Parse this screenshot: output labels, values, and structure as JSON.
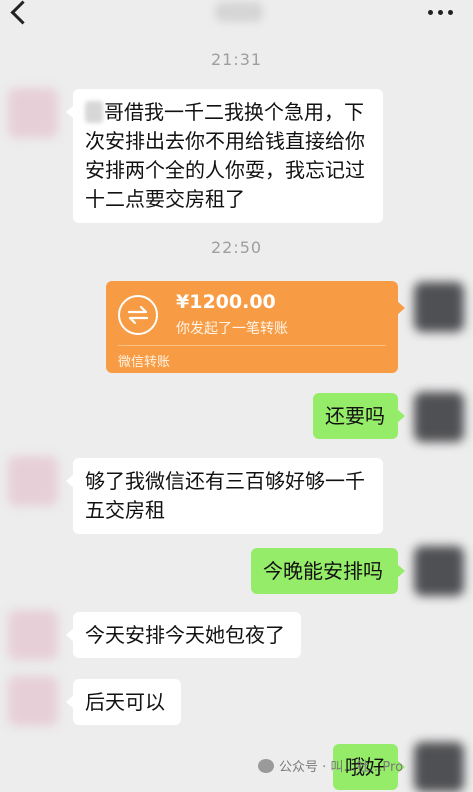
{
  "header": {
    "back_icon": "back-chevron-icon",
    "more_icon": "more-dots-icon"
  },
  "messages": [
    {
      "type": "time",
      "text": "21:31"
    },
    {
      "type": "text",
      "side": "left",
      "lines": [
        "哥借我一千二我换个急用，下",
        "次安排出去你不用给钱直接给你",
        "安排两个全的人你耍，我忘记过",
        "十二点要交房租了"
      ]
    },
    {
      "type": "time",
      "text": "22:50"
    },
    {
      "type": "transfer",
      "side": "right",
      "amount": "¥1200.00",
      "desc": "你发起了一笔转账",
      "footer": "微信转账",
      "color": "#f79c44"
    },
    {
      "type": "text",
      "side": "right",
      "text": "还要吗"
    },
    {
      "type": "text",
      "side": "left",
      "lines": [
        "够了我微信还有三百够好够一千",
        "五交房租"
      ]
    },
    {
      "type": "text",
      "side": "right",
      "text": "今晚能安排吗"
    },
    {
      "type": "text",
      "side": "left",
      "text": "今天安排今天她包夜了"
    },
    {
      "type": "text",
      "side": "left",
      "text": "后天可以"
    },
    {
      "type": "text",
      "side": "right",
      "text": "哦好"
    }
  ],
  "watermark": {
    "text": "公众号 · 叫…社…Pro"
  },
  "colors": {
    "background": "#ededed",
    "sent_bubble": "#95ec69",
    "received_bubble": "#ffffff"
  }
}
